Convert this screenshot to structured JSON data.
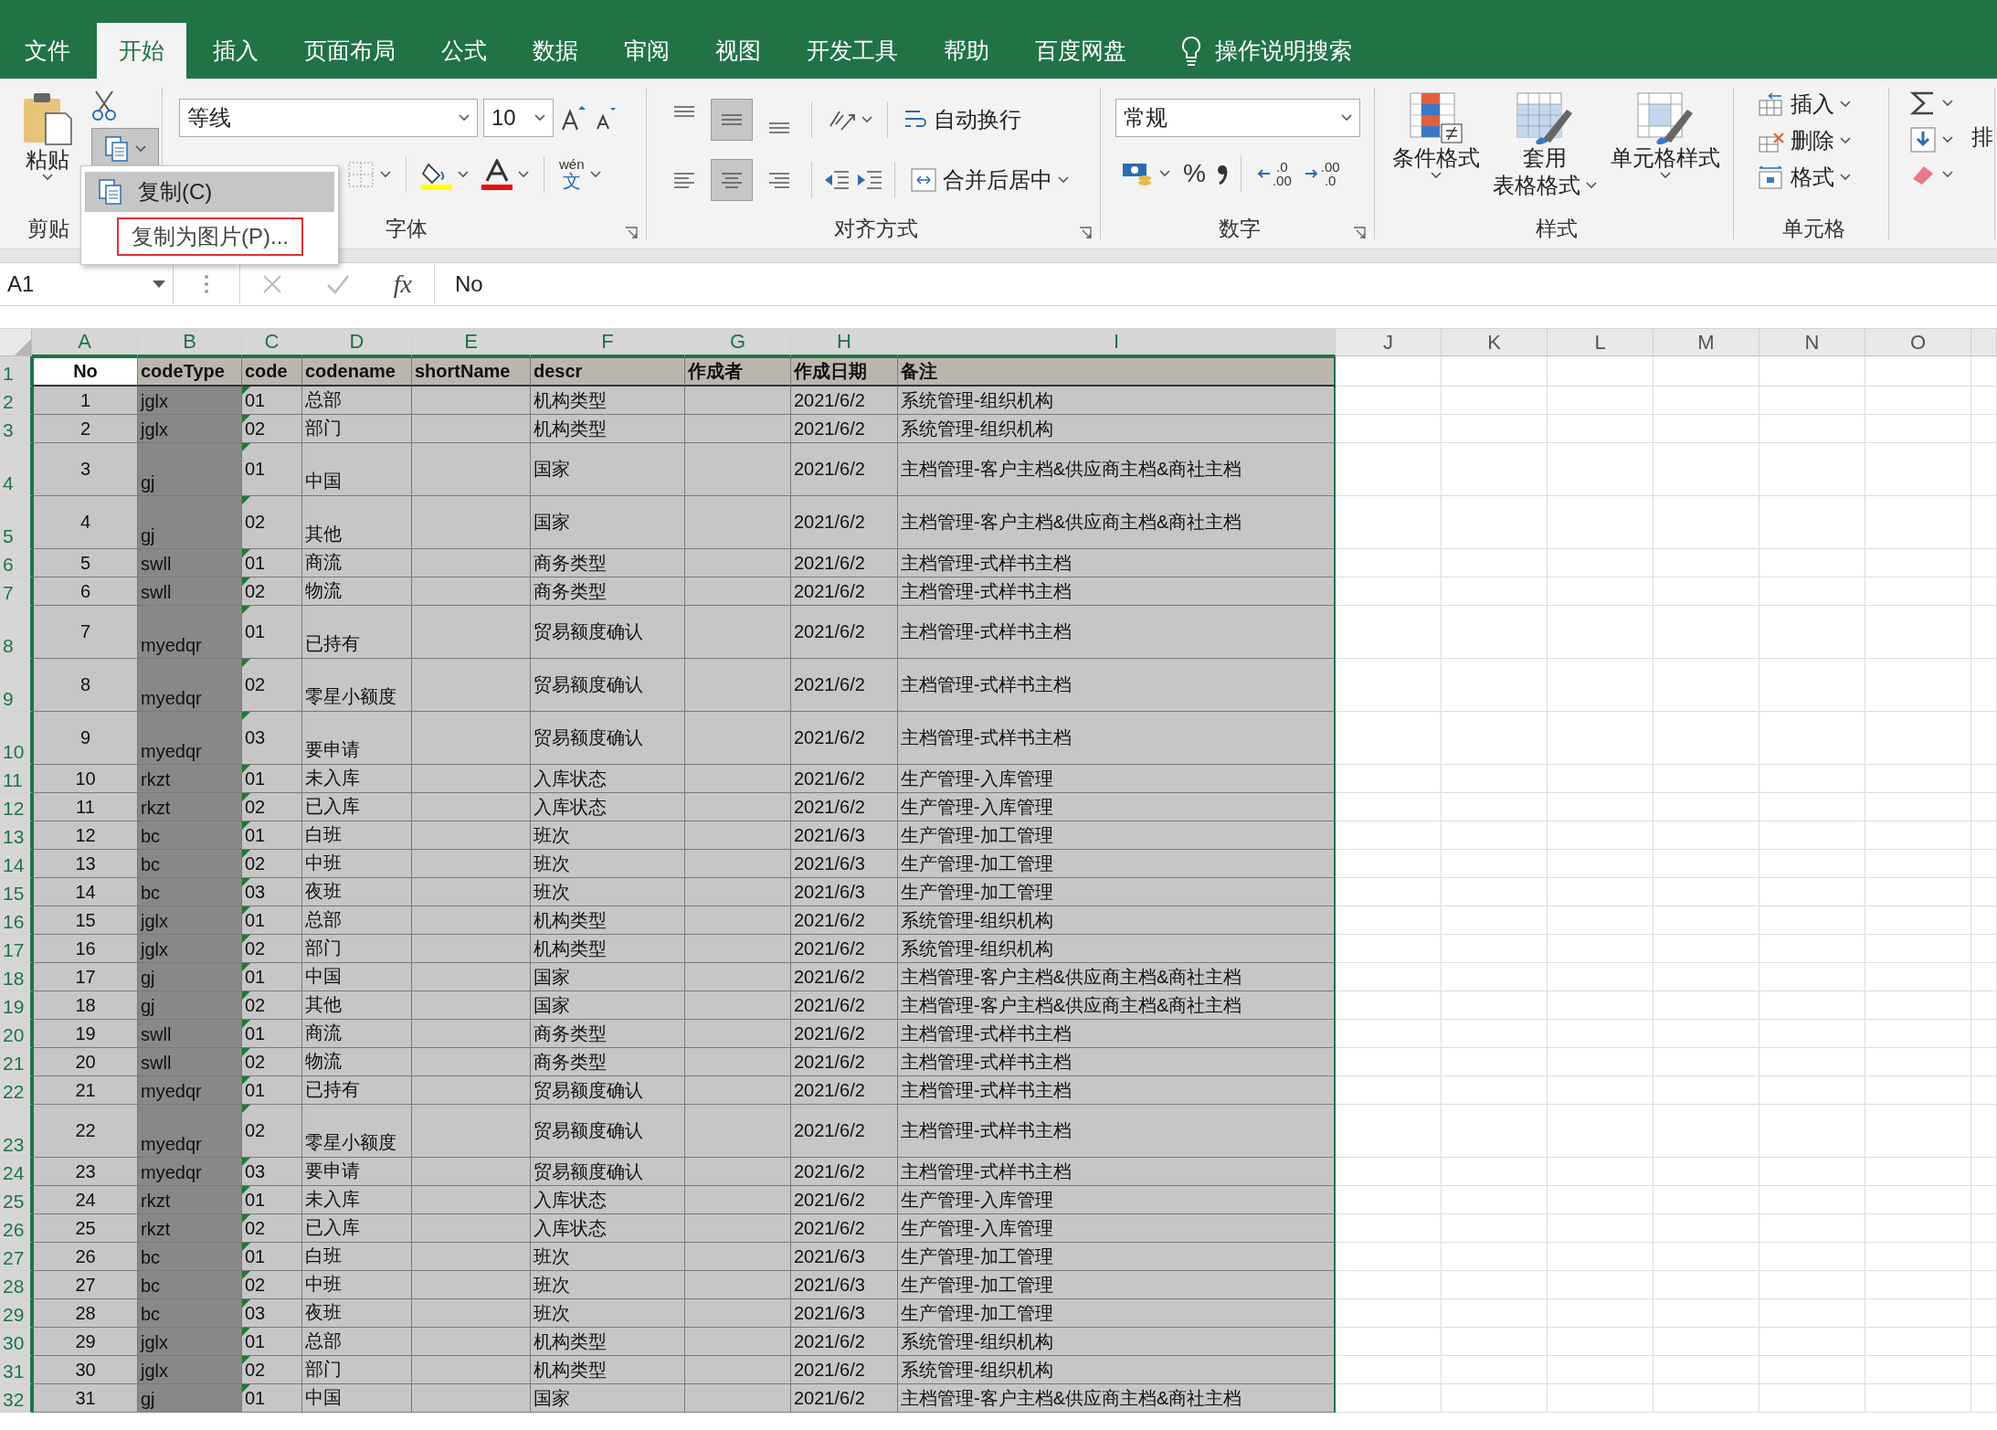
{
  "tabs": [
    {
      "label": "文件",
      "selected": false
    },
    {
      "label": "开始",
      "selected": true
    },
    {
      "label": "插入",
      "selected": false
    },
    {
      "label": "页面布局",
      "selected": false
    },
    {
      "label": "公式",
      "selected": false
    },
    {
      "label": "数据",
      "selected": false
    },
    {
      "label": "审阅",
      "selected": false
    },
    {
      "label": "视图",
      "selected": false
    },
    {
      "label": "开发工具",
      "selected": false
    },
    {
      "label": "帮助",
      "selected": false
    },
    {
      "label": "百度网盘",
      "selected": false
    }
  ],
  "tell_me": "操作说明搜索",
  "ribbon": {
    "clipboard": {
      "paste": "粘贴",
      "label": "剪贴"
    },
    "font": {
      "font_name": "等线",
      "font_size": "10",
      "phonetic": "wén",
      "phonetic_char": "文",
      "label": "字体"
    },
    "alignment": {
      "vertical": [
        {
          "kind": "top",
          "pressed": false
        },
        {
          "kind": "middle",
          "pressed": true
        },
        {
          "kind": "bottom",
          "pressed": false
        }
      ],
      "horizontal": [
        {
          "kind": "left",
          "pressed": false
        },
        {
          "kind": "center",
          "pressed": true
        },
        {
          "kind": "right",
          "pressed": false
        }
      ],
      "wrap_text": "自动换行",
      "merge_center": "合并后居中",
      "label": "对齐方式"
    },
    "number": {
      "format": "常规",
      "percent": "%",
      "increase_decimal": [
        ".0",
        ".00"
      ],
      "decrease_decimal": [
        ".00",
        ".0"
      ],
      "label": "数字"
    },
    "styles": {
      "conditional": [
        "条件格式"
      ],
      "format_table": [
        "套用",
        "表格格式"
      ],
      "cell_styles": [
        "单元格样式"
      ],
      "label": "样式"
    },
    "cells": {
      "insert": "插入",
      "delete": "删除",
      "format": "格式",
      "label": "单元格"
    },
    "editing": {
      "sort_partial": "排"
    }
  },
  "popup_menu": {
    "items": [
      {
        "label": "复制(C)",
        "selected": true,
        "outlined": false
      },
      {
        "label": "复制为图片(P)...",
        "selected": false,
        "outlined": true
      }
    ]
  },
  "formula_bar": {
    "name_box": "A1",
    "fx": "fx",
    "value": "No"
  },
  "sheet": {
    "columns": [
      {
        "letter": "A",
        "selected": true
      },
      {
        "letter": "B",
        "selected": true
      },
      {
        "letter": "C",
        "selected": true
      },
      {
        "letter": "D",
        "selected": true
      },
      {
        "letter": "E",
        "selected": true
      },
      {
        "letter": "F",
        "selected": true
      },
      {
        "letter": "G",
        "selected": true
      },
      {
        "letter": "H",
        "selected": true
      },
      {
        "letter": "I",
        "selected": true
      },
      {
        "letter": "J",
        "selected": false
      },
      {
        "letter": "K",
        "selected": false
      },
      {
        "letter": "L",
        "selected": false
      },
      {
        "letter": "M",
        "selected": false
      },
      {
        "letter": "N",
        "selected": false
      },
      {
        "letter": "O",
        "selected": false
      }
    ],
    "header": {
      "row_number": "1",
      "selected": true,
      "cells": [
        "No",
        "codeType",
        "code",
        "codename",
        "shortName",
        "descr",
        "作成者",
        "作成日期",
        "备注"
      ]
    },
    "rows": [
      {
        "row_number": "2",
        "selected": true,
        "tall": false,
        "flagged": true,
        "no": "1",
        "code_type": "jglx",
        "code": "01",
        "codename": "总部",
        "descr": "机构类型",
        "date": "2021/6/2",
        "note": "系统管理-组织机构"
      },
      {
        "row_number": "3",
        "selected": true,
        "tall": false,
        "flagged": true,
        "no": "2",
        "code_type": "jglx",
        "code": "02",
        "codename": "部门",
        "descr": "机构类型",
        "date": "2021/6/2",
        "note": "系统管理-组织机构"
      },
      {
        "row_number": "4",
        "selected": true,
        "tall": true,
        "flagged": true,
        "no": "3",
        "code_type": "gj",
        "code": "01",
        "codename": "中国",
        "descr": "国家",
        "date": "2021/6/2",
        "note": "主档管理-客户主档&供应商主档&商社主档"
      },
      {
        "row_number": "5",
        "selected": true,
        "tall": true,
        "flagged": true,
        "no": "4",
        "code_type": "gj",
        "code": "02",
        "codename": "其他",
        "descr": "国家",
        "date": "2021/6/2",
        "note": "主档管理-客户主档&供应商主档&商社主档"
      },
      {
        "row_number": "6",
        "selected": true,
        "tall": false,
        "flagged": true,
        "no": "5",
        "code_type": "swll",
        "code": "01",
        "codename": "商流",
        "descr": "商务类型",
        "date": "2021/6/2",
        "note": "主档管理-式样书主档"
      },
      {
        "row_number": "7",
        "selected": true,
        "tall": false,
        "flagged": true,
        "no": "6",
        "code_type": "swll",
        "code": "02",
        "codename": "物流",
        "descr": "商务类型",
        "date": "2021/6/2",
        "note": "主档管理-式样书主档"
      },
      {
        "row_number": "8",
        "selected": true,
        "tall": true,
        "flagged": true,
        "no": "7",
        "code_type": "myedqr",
        "code": "01",
        "codename": "已持有",
        "descr": "贸易额度确认",
        "date": "2021/6/2",
        "note": "主档管理-式样书主档"
      },
      {
        "row_number": "9",
        "selected": true,
        "tall": true,
        "flagged": true,
        "no": "8",
        "code_type": "myedqr",
        "code": "02",
        "codename": "零星小额度",
        "descr": "贸易额度确认",
        "date": "2021/6/2",
        "note": "主档管理-式样书主档"
      },
      {
        "row_number": "10",
        "selected": true,
        "tall": true,
        "flagged": true,
        "no": "9",
        "code_type": "myedqr",
        "code": "03",
        "codename": "要申请",
        "descr": "贸易额度确认",
        "date": "2021/6/2",
        "note": "主档管理-式样书主档"
      },
      {
        "row_number": "11",
        "selected": true,
        "tall": false,
        "flagged": true,
        "no": "10",
        "code_type": "rkzt",
        "code": "01",
        "codename": "未入库",
        "descr": "入库状态",
        "date": "2021/6/2",
        "note": "生产管理-入库管理"
      },
      {
        "row_number": "12",
        "selected": true,
        "tall": false,
        "flagged": true,
        "no": "11",
        "code_type": "rkzt",
        "code": "02",
        "codename": "已入库",
        "descr": "入库状态",
        "date": "2021/6/2",
        "note": "生产管理-入库管理"
      },
      {
        "row_number": "13",
        "selected": true,
        "tall": false,
        "flagged": true,
        "no": "12",
        "code_type": "bc",
        "code": "01",
        "codename": "白班",
        "descr": "班次",
        "date": "2021/6/3",
        "note": "生产管理-加工管理"
      },
      {
        "row_number": "14",
        "selected": true,
        "tall": false,
        "flagged": true,
        "no": "13",
        "code_type": "bc",
        "code": "02",
        "codename": "中班",
        "descr": "班次",
        "date": "2021/6/3",
        "note": "生产管理-加工管理"
      },
      {
        "row_number": "15",
        "selected": true,
        "tall": false,
        "flagged": true,
        "no": "14",
        "code_type": "bc",
        "code": "03",
        "codename": "夜班",
        "descr": "班次",
        "date": "2021/6/3",
        "note": "生产管理-加工管理"
      },
      {
        "row_number": "16",
        "selected": true,
        "tall": false,
        "flagged": true,
        "no": "15",
        "code_type": "jglx",
        "code": "01",
        "codename": "总部",
        "descr": "机构类型",
        "date": "2021/6/2",
        "note": "系统管理-组织机构"
      },
      {
        "row_number": "17",
        "selected": true,
        "tall": false,
        "flagged": true,
        "no": "16",
        "code_type": "jglx",
        "code": "02",
        "codename": "部门",
        "descr": "机构类型",
        "date": "2021/6/2",
        "note": "系统管理-组织机构"
      },
      {
        "row_number": "18",
        "selected": true,
        "tall": false,
        "flagged": true,
        "no": "17",
        "code_type": "gj",
        "code": "01",
        "codename": "中国",
        "descr": "国家",
        "date": "2021/6/2",
        "note": "主档管理-客户主档&供应商主档&商社主档"
      },
      {
        "row_number": "19",
        "selected": true,
        "tall": false,
        "flagged": true,
        "no": "18",
        "code_type": "gj",
        "code": "02",
        "codename": "其他",
        "descr": "国家",
        "date": "2021/6/2",
        "note": "主档管理-客户主档&供应商主档&商社主档"
      },
      {
        "row_number": "20",
        "selected": true,
        "tall": false,
        "flagged": true,
        "no": "19",
        "code_type": "swll",
        "code": "01",
        "codename": "商流",
        "descr": "商务类型",
        "date": "2021/6/2",
        "note": "主档管理-式样书主档"
      },
      {
        "row_number": "21",
        "selected": true,
        "tall": false,
        "flagged": true,
        "no": "20",
        "code_type": "swll",
        "code": "02",
        "codename": "物流",
        "descr": "商务类型",
        "date": "2021/6/2",
        "note": "主档管理-式样书主档"
      },
      {
        "row_number": "22",
        "selected": true,
        "tall": false,
        "flagged": true,
        "no": "21",
        "code_type": "myedqr",
        "code": "01",
        "codename": "已持有",
        "descr": "贸易额度确认",
        "date": "2021/6/2",
        "note": "主档管理-式样书主档"
      },
      {
        "row_number": "23",
        "selected": true,
        "tall": true,
        "flagged": true,
        "no": "22",
        "code_type": "myedqr",
        "code": "02",
        "codename": "零星小额度",
        "descr": "贸易额度确认",
        "date": "2021/6/2",
        "note": "主档管理-式样书主档"
      },
      {
        "row_number": "24",
        "selected": true,
        "tall": false,
        "flagged": true,
        "no": "23",
        "code_type": "myedqr",
        "code": "03",
        "codename": "要申请",
        "descr": "贸易额度确认",
        "date": "2021/6/2",
        "note": "主档管理-式样书主档"
      },
      {
        "row_number": "25",
        "selected": true,
        "tall": false,
        "flagged": true,
        "no": "24",
        "code_type": "rkzt",
        "code": "01",
        "codename": "未入库",
        "descr": "入库状态",
        "date": "2021/6/2",
        "note": "生产管理-入库管理"
      },
      {
        "row_number": "26",
        "selected": true,
        "tall": false,
        "flagged": true,
        "no": "25",
        "code_type": "rkzt",
        "code": "02",
        "codename": "已入库",
        "descr": "入库状态",
        "date": "2021/6/2",
        "note": "生产管理-入库管理"
      },
      {
        "row_number": "27",
        "selected": true,
        "tall": false,
        "flagged": true,
        "no": "26",
        "code_type": "bc",
        "code": "01",
        "codename": "白班",
        "descr": "班次",
        "date": "2021/6/3",
        "note": "生产管理-加工管理"
      },
      {
        "row_number": "28",
        "selected": true,
        "tall": false,
        "flagged": true,
        "no": "27",
        "code_type": "bc",
        "code": "02",
        "codename": "中班",
        "descr": "班次",
        "date": "2021/6/3",
        "note": "生产管理-加工管理"
      },
      {
        "row_number": "29",
        "selected": true,
        "tall": false,
        "flagged": true,
        "no": "28",
        "code_type": "bc",
        "code": "03",
        "codename": "夜班",
        "descr": "班次",
        "date": "2021/6/3",
        "note": "生产管理-加工管理"
      },
      {
        "row_number": "30",
        "selected": true,
        "tall": false,
        "flagged": true,
        "no": "29",
        "code_type": "jglx",
        "code": "01",
        "codename": "总部",
        "descr": "机构类型",
        "date": "2021/6/2",
        "note": "系统管理-组织机构"
      },
      {
        "row_number": "31",
        "selected": true,
        "tall": false,
        "flagged": true,
        "no": "30",
        "code_type": "jglx",
        "code": "02",
        "codename": "部门",
        "descr": "机构类型",
        "date": "2021/6/2",
        "note": "系统管理-组织机构"
      },
      {
        "row_number": "32",
        "selected": true,
        "tall": false,
        "flagged": true,
        "no": "31",
        "code_type": "gj",
        "code": "01",
        "codename": "中国",
        "descr": "国家",
        "date": "2021/6/2",
        "note": "主档管理-客户主档&供应商主档&商社主档"
      }
    ]
  }
}
